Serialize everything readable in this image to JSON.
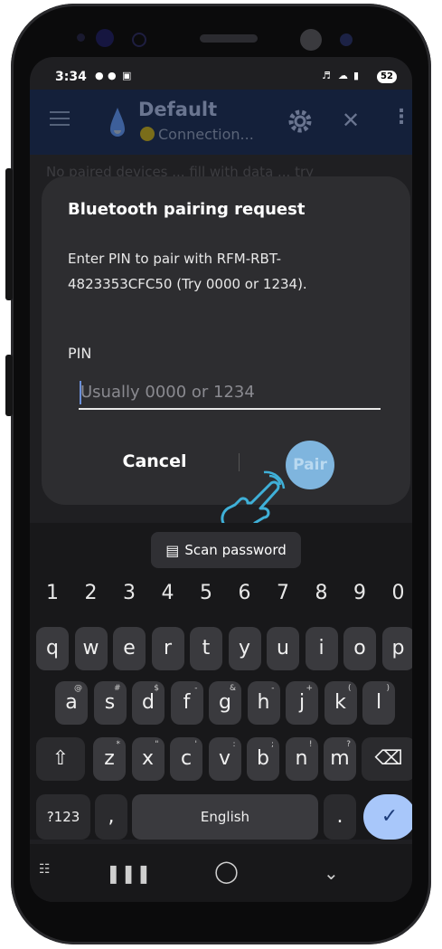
{
  "status_bar": {
    "time": "3:34",
    "battery": "52"
  },
  "app_bar": {
    "title": "Default",
    "subtitle": "Connection..."
  },
  "background_text": "No paired devices ... fill with data ... try",
  "dialog": {
    "title": "Bluetooth pairing request",
    "message": "Enter PIN to pair with RFM-RBT-4823353CFC50 (Try 0000 or 1234).",
    "pin_label": "PIN",
    "pin_placeholder": "Usually 0000 or 1234",
    "pin_value": "",
    "cancel_label": "Cancel",
    "pair_label": "Pair"
  },
  "keyboard": {
    "scan_password_label": "Scan password",
    "number_row": [
      "1",
      "2",
      "3",
      "4",
      "5",
      "6",
      "7",
      "8",
      "9",
      "0"
    ],
    "row1": [
      "q",
      "w",
      "e",
      "r",
      "t",
      "y",
      "u",
      "i",
      "o",
      "p"
    ],
    "row2": [
      {
        "k": "a",
        "s": "@"
      },
      {
        "k": "s",
        "s": "#"
      },
      {
        "k": "d",
        "s": "$"
      },
      {
        "k": "f",
        "s": "-"
      },
      {
        "k": "g",
        "s": "&"
      },
      {
        "k": "h",
        "s": "-"
      },
      {
        "k": "j",
        "s": "+"
      },
      {
        "k": "k",
        "s": "("
      },
      {
        "k": "l",
        "s": ")"
      }
    ],
    "row3": [
      {
        "k": "z",
        "s": "*"
      },
      {
        "k": "x",
        "s": "\""
      },
      {
        "k": "c",
        "s": "'"
      },
      {
        "k": "v",
        "s": ":"
      },
      {
        "k": "b",
        "s": ";"
      },
      {
        "k": "n",
        "s": "!"
      },
      {
        "k": "m",
        "s": "?"
      }
    ],
    "sym_label": "?123",
    "comma_label": ",",
    "space_label": "English",
    "period_label": "."
  },
  "colors": {
    "accent": "#7fb5de",
    "appbar": "#14203a",
    "dialog": "#2d2d30"
  }
}
